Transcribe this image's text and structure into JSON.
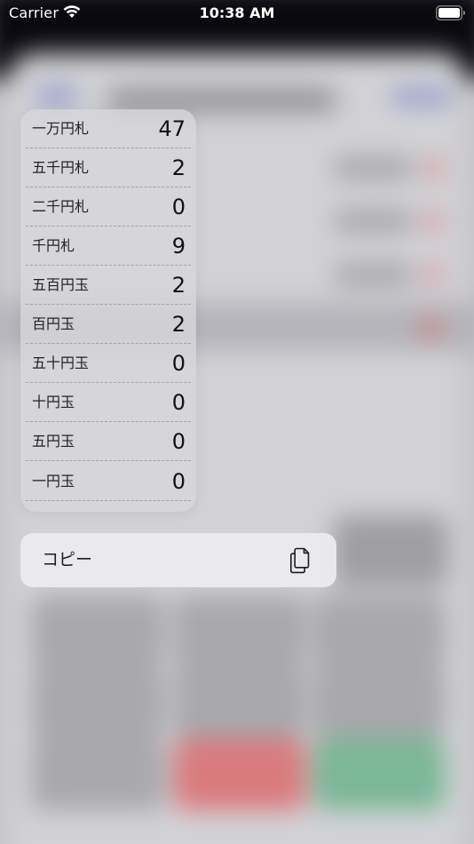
{
  "status_bar": {
    "carrier": "Carrier",
    "time": "10:38 AM",
    "wifi_icon": "wifi-icon",
    "battery_icon": "battery-full-icon"
  },
  "denominations": [
    {
      "label": "一万円札",
      "count": "47"
    },
    {
      "label": "五千円札",
      "count": "2"
    },
    {
      "label": "二千円札",
      "count": "0"
    },
    {
      "label": "千円札",
      "count": "9"
    },
    {
      "label": "五百円玉",
      "count": "2"
    },
    {
      "label": "百円玉",
      "count": "2"
    },
    {
      "label": "五十円玉",
      "count": "0"
    },
    {
      "label": "十円玉",
      "count": "0"
    },
    {
      "label": "五円玉",
      "count": "0"
    },
    {
      "label": "一円玉",
      "count": "0"
    }
  ],
  "context_menu": {
    "copy_label": "コピー",
    "copy_icon": "doc-on-doc-icon"
  },
  "colors": {
    "red_button": "#d97b7e",
    "green_button": "#7cb796"
  }
}
